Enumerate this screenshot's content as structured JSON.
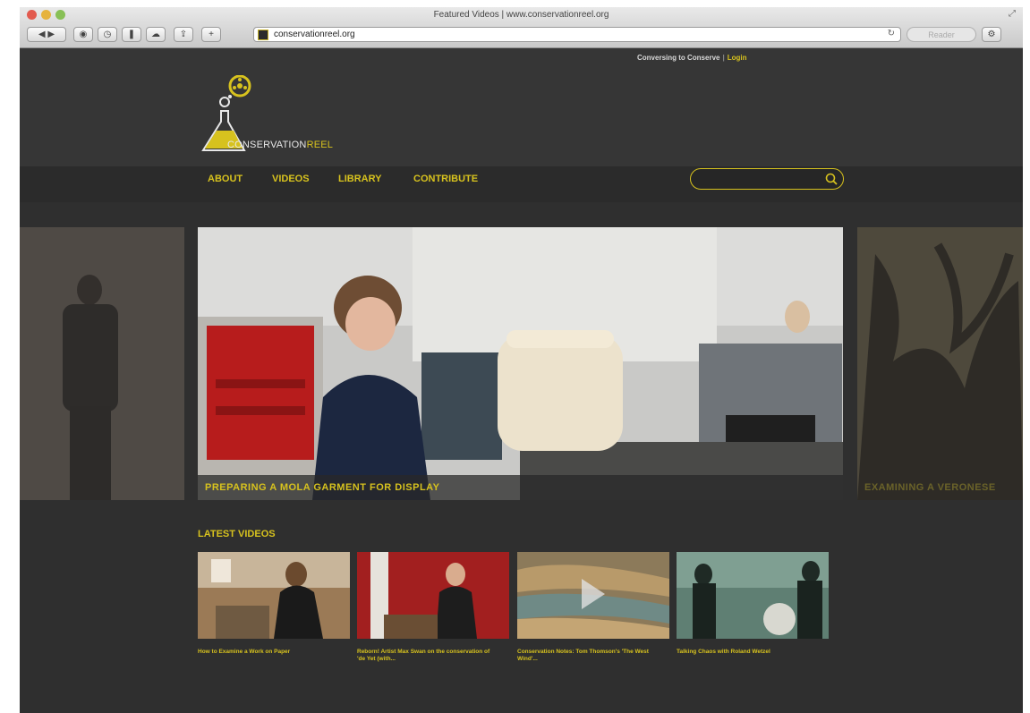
{
  "browser": {
    "window_title": "Featured Videos | www.conservationreel.org",
    "url": "conservationreel.org",
    "reader_label": "Reader"
  },
  "header": {
    "tagline": "Conversing to Conserve",
    "login": "Login",
    "logo_word_white": "CONSERVATION",
    "logo_word_yellow": "REEL"
  },
  "nav": {
    "items": [
      "ABOUT",
      "VIDEOS",
      "LIBRARY",
      "CONTRIBUTE"
    ],
    "search_placeholder": ""
  },
  "carousel": {
    "main_caption": "PREPARING A MOLA GARMENT FOR DISPLAY",
    "next_caption": "EXAMINING A VERONESE"
  },
  "latest": {
    "title": "LATEST VIDEOS",
    "videos": [
      {
        "title": "How to Examine a Work on Paper"
      },
      {
        "title": "Reborn! Artist Max Swan on the conservation of 'de Yet (with..."
      },
      {
        "title": "Conservation Notes: Tom Thomson's 'The West Wind'..."
      },
      {
        "title": "Talking Chaos with Roland Wetzel"
      }
    ]
  },
  "colors": {
    "accent": "#d7c21e",
    "page_bg": "#2f2f2f"
  }
}
